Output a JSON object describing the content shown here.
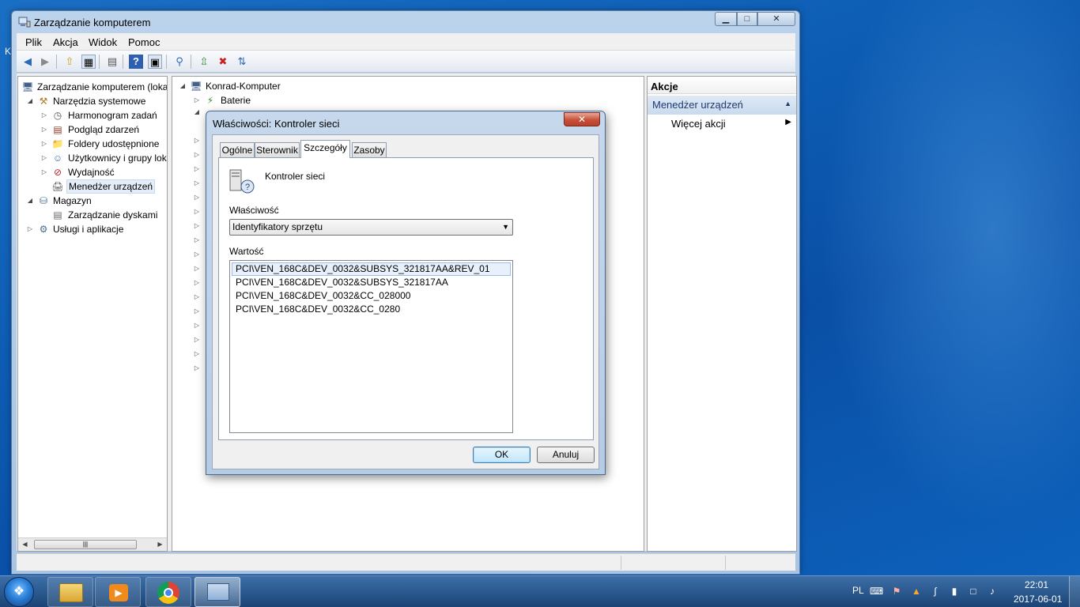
{
  "window": {
    "title": "Zarządzanie komputerem",
    "min_symbol": "▁",
    "max_symbol": "□",
    "close_symbol": "✕"
  },
  "menu": [
    "Plik",
    "Akcja",
    "Widok",
    "Pomoc"
  ],
  "toolbar": {
    "buttons": [
      "back-icon",
      "forward-icon",
      "up-icon",
      "show-tree-icon",
      "properties-icon",
      "help-icon",
      "show-action-pane-icon",
      "scan-hardware-icon",
      "update-driver-icon",
      "uninstall-icon",
      "enable-device-icon"
    ]
  },
  "tree": {
    "root": "Zarządzanie komputerem (loka",
    "system_tools": "Narzędzia systemowe",
    "task_scheduler": "Harmonogram zadań",
    "event_viewer": "Podgląd zdarzeń",
    "shared_folders": "Foldery udostępnione",
    "local_users": "Użytkownicy i grupy lok",
    "performance": "Wydajność",
    "device_manager": "Menedżer urządzeń",
    "storage": "Magazyn",
    "disk_management": "Zarządzanie dyskami",
    "services_apps": "Usługi i aplikacje"
  },
  "devices": {
    "computer": "Konrad-Komputer",
    "batteries": "Baterie"
  },
  "actions": {
    "header": "Akcje",
    "group": "Menedżer urządzeń",
    "more": "Więcej akcji"
  },
  "dialog": {
    "title": "Właściwości: Kontroler sieci",
    "close_symbol": "✕",
    "tabs": [
      "Ogólne",
      "Sterownik",
      "Szczegóły",
      "Zasoby"
    ],
    "active_tab": "Szczegóły",
    "device_name": "Kontroler sieci",
    "property_label": "Właściwość",
    "property_value": "Identyfikatory sprzętu",
    "value_label": "Wartość",
    "values": [
      "PCI\\VEN_168C&DEV_0032&SUBSYS_321817AA&REV_01",
      "PCI\\VEN_168C&DEV_0032&SUBSYS_321817AA",
      "PCI\\VEN_168C&DEV_0032&CC_028000",
      "PCI\\VEN_168C&DEV_0032&CC_0280"
    ],
    "ok": "OK",
    "cancel": "Anuluj"
  },
  "taskbar": {
    "apps": [
      "file-explorer-icon",
      "media-player-icon",
      "chrome-icon",
      "computer-management-icon"
    ],
    "language": "PL",
    "time": "22:01",
    "date": "2017-06-01"
  },
  "desktop": {
    "edge_text": "K"
  }
}
